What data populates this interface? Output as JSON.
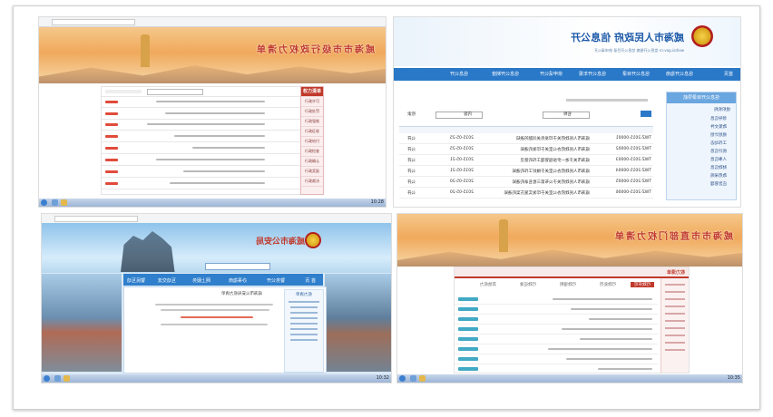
{
  "shots": {
    "topleft": {
      "banner_title": "威海市市级行政权力清单",
      "sidebar_head": "权力清单",
      "sidebar_items": [
        "行政许可",
        "行政处罚",
        "行政强制",
        "行政征收",
        "行政给付",
        "行政检查",
        "行政确认",
        "行政奖励",
        "行政裁决",
        "其他权力",
        "公共服务"
      ],
      "tag_label": "权力清单",
      "clock": "10:28"
    },
    "topright": {
      "title": "威海市人民政府 信息公开",
      "subtitle": "weihai.gov.cn 信息公开指南 信息公开目录 依申请公开",
      "nav": [
        "首页",
        "信息公开指南",
        "信息公开目录",
        "信息公开年报",
        "依申请公开",
        "信息公开制度",
        "信息公开"
      ],
      "sidebar_title": "信息公开目录导航",
      "tree": [
        "组织机构",
        "领导信息",
        "政策文件",
        "规划计划",
        "工作动态",
        "统计信息",
        "人事信息",
        "财政信息",
        "政府采购",
        "应急管理"
      ],
      "search_labels": [
        "检索",
        "内容",
        "名称"
      ],
      "rows": [
        {
          "no": "TWZ-2015-00001",
          "title": "威海市人民政府关于印发有关问题的通知",
          "date": "2015-05-25",
          "col": "公开"
        },
        {
          "no": "TWZ-2015-00002",
          "title": "威海市人民政府办公室关于印发的通知",
          "date": "2015-05-25",
          "col": "公开"
        },
        {
          "no": "TWZ-2015-00003",
          "title": "威海市关于进一步加强管理工作的意见",
          "date": "2015-05-21",
          "col": "公开"
        },
        {
          "no": "TWZ-2015-00004",
          "title": "威海市人民政府办公室关于做好工作的通知",
          "date": "2015-05-21",
          "col": "公开"
        },
        {
          "no": "TWZ-2015-00005",
          "title": "威海市人民政府关于公布第三批名录的通知",
          "date": "2015-05-20",
          "col": "公开"
        },
        {
          "no": "TWZ-2015-00006",
          "title": "威海市人民政府办公室关于印发实施方案的通知",
          "date": "2015-05-20",
          "col": "公开"
        }
      ]
    },
    "bottomleft": {
      "title": "威海市公安局",
      "nav": [
        "首 页",
        "警务公开",
        "办事指南",
        "网上服务",
        "互动交流",
        "警民互动"
      ],
      "sidebar_title": "权力清单",
      "content_heading": "威海市公安局权力清单",
      "clock": "10:32"
    },
    "bottomright": {
      "banner_title": "威海市市直部门权力清单",
      "section_title": "权力清单",
      "tabs": [
        "行政许可",
        "行政处罚",
        "行政强制",
        "行政征收",
        "其他权力"
      ],
      "action_label": "查看详情",
      "clock": "10:35"
    }
  },
  "colors": {
    "gov_blue": "#2a78c8",
    "power_red": "#c0392b",
    "banner_orange": "#f0a95c",
    "button_teal": "#41a9c4"
  }
}
